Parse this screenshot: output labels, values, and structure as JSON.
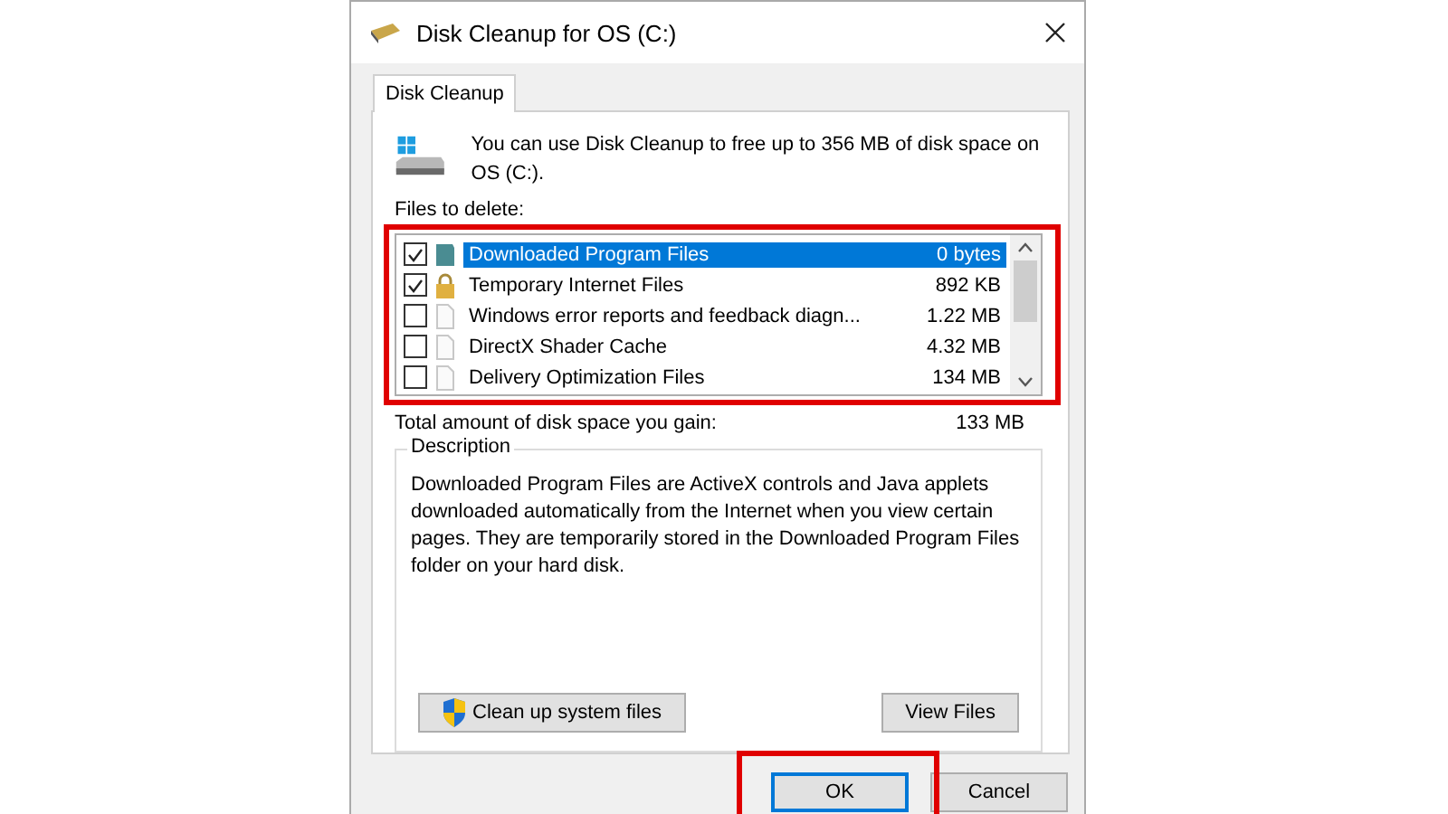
{
  "window": {
    "title": "Disk Cleanup for OS (C:)"
  },
  "tabs": [
    {
      "label": "Disk Cleanup",
      "selected": true
    }
  ],
  "intro": "You can use Disk Cleanup to free up to 356 MB of disk space on OS (C:).",
  "files_label": "Files to delete:",
  "files": [
    {
      "name": "Downloaded Program Files",
      "size": "0 bytes",
      "checked": true,
      "selected": true,
      "kind": "program"
    },
    {
      "name": "Temporary Internet Files",
      "size": "892 KB",
      "checked": true,
      "selected": false,
      "kind": "locked"
    },
    {
      "name": "Windows error reports and feedback diagn...",
      "size": "1.22 MB",
      "checked": false,
      "selected": false,
      "kind": "file"
    },
    {
      "name": "DirectX Shader Cache",
      "size": "4.32 MB",
      "checked": false,
      "selected": false,
      "kind": "file"
    },
    {
      "name": "Delivery Optimization Files",
      "size": "134 MB",
      "checked": false,
      "selected": false,
      "kind": "file"
    }
  ],
  "total": {
    "label": "Total amount of disk space you gain:",
    "value": "133 MB"
  },
  "description": {
    "title": "Description",
    "text": "Downloaded Program Files are ActiveX controls and Java applets downloaded automatically from the Internet when you view certain pages. They are temporarily stored in the Downloaded Program Files folder on your hard disk."
  },
  "actions": [
    {
      "label": "Clean up system files",
      "kind": "shield"
    },
    {
      "label": "View Files",
      "kind": "plain"
    }
  ],
  "buttons": [
    {
      "label": "OK",
      "kind": "default"
    },
    {
      "label": "Cancel",
      "kind": "normal"
    }
  ]
}
